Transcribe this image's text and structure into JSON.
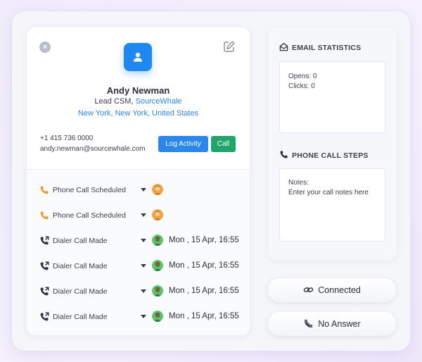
{
  "contact": {
    "name": "Andy Newman",
    "title": "Lead CSM,",
    "company": "SourceWhale",
    "location": "New York, New York, United States",
    "phone": "+1 415 736 0000",
    "email": "andy.newman@sourcewhale.com"
  },
  "actions": {
    "log_activity_label": "Log Activity",
    "call_label": "Call"
  },
  "activities": [
    {
      "label": "Phone Call Scheduled",
      "date": "",
      "icon": "phone-icon",
      "avatar": "avatar-orange"
    },
    {
      "label": "Phone Call Scheduled",
      "date": "",
      "icon": "phone-icon",
      "avatar": "avatar-orange"
    },
    {
      "label": "Dialer Call Made",
      "date": "Mon , 15 Apr, 16:55",
      "icon": "phone-outgoing-icon",
      "avatar": "avatar-green"
    },
    {
      "label": "Dialer Call Made",
      "date": "Mon , 15 Apr, 16:55",
      "icon": "phone-outgoing-icon",
      "avatar": "avatar-green"
    },
    {
      "label": "Dialer Call Made",
      "date": "Mon , 15 Apr, 16:55",
      "icon": "phone-outgoing-icon",
      "avatar": "avatar-green"
    },
    {
      "label": "Dialer Call Made",
      "date": "Mon , 15 Apr, 16:55",
      "icon": "phone-outgoing-icon",
      "avatar": "avatar-green"
    }
  ],
  "email_statistics": {
    "heading": "EMAIL STATISTICS",
    "opens": "Opens: 0",
    "clicks": "Clicks: 0"
  },
  "phone_call_steps": {
    "heading": "PHONE CALL STEPS",
    "notes_label": "Notes:",
    "notes_placeholder": "Enter your call notes here"
  },
  "outcomes": {
    "connected_label": "Connected",
    "no_answer_label": "No Answer"
  },
  "colors": {
    "primary_blue": "#2c87ea",
    "call_green": "#21a56a",
    "link_blue": "#2a87e6",
    "phone_icon_orange": "#f29a2e"
  }
}
